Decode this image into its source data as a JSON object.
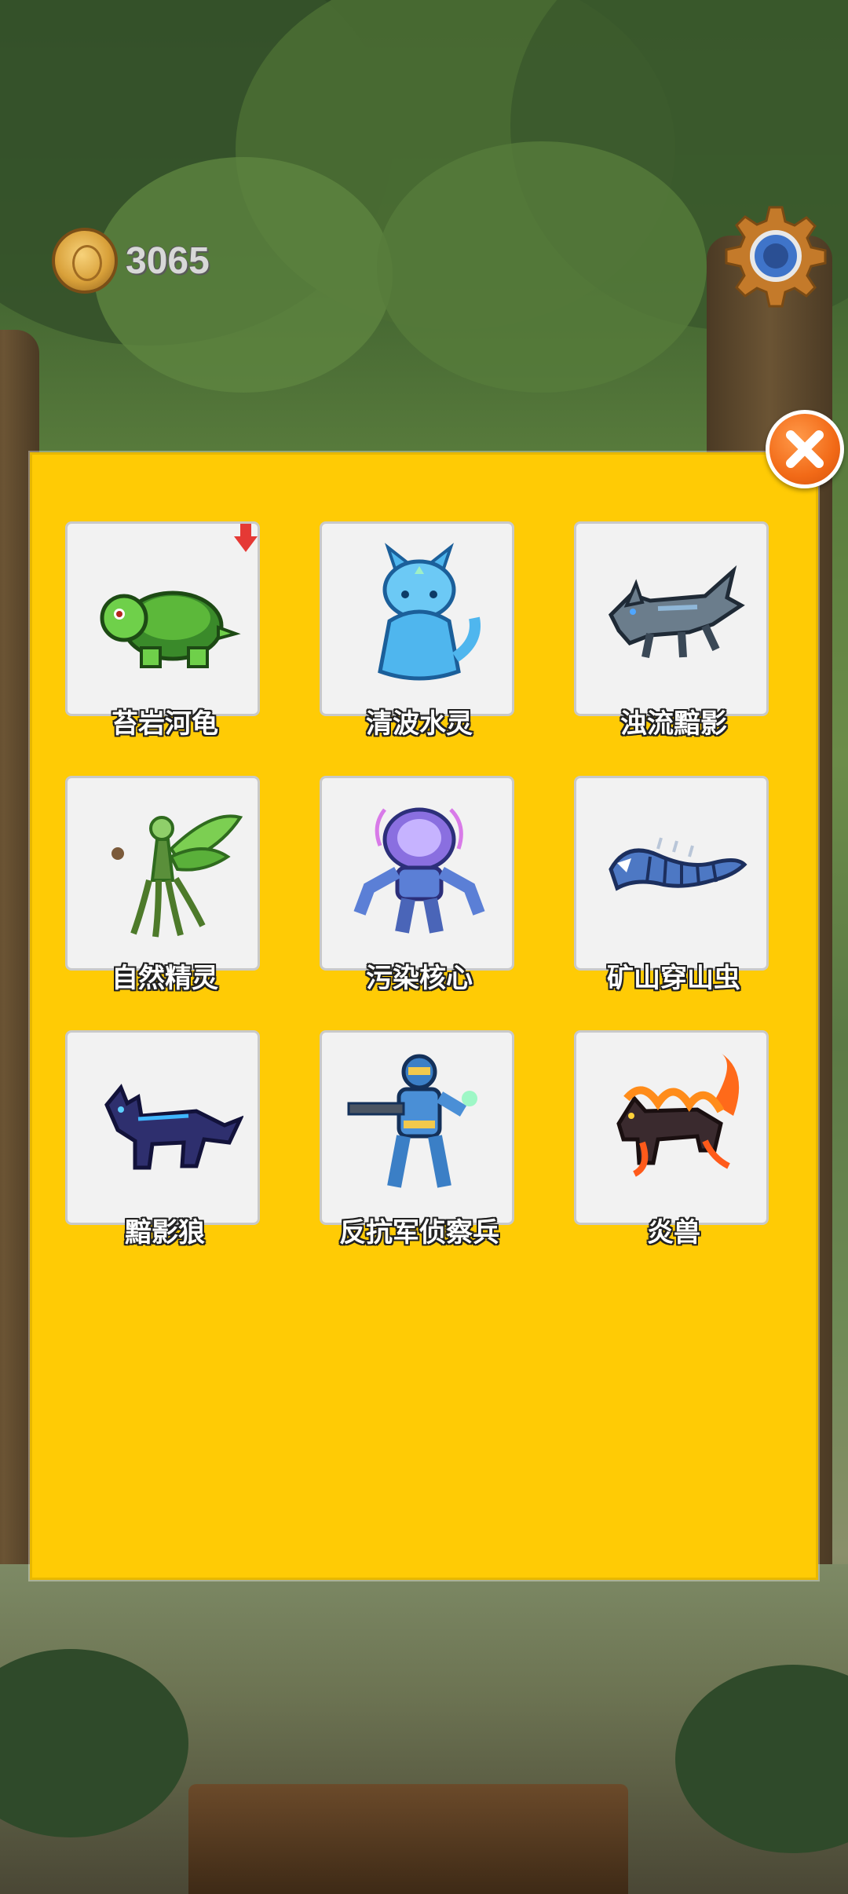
{
  "hud": {
    "coins": "3065",
    "coin_icon": "gold-coin-icon",
    "settings_icon": "gear-icon"
  },
  "collection": {
    "close_icon": "close-icon",
    "monsters": [
      {
        "name": "苔岩河龟",
        "icon": "green-turtle-icon",
        "has_new_badge": true
      },
      {
        "name": "清波水灵",
        "icon": "water-spirit-icon",
        "has_new_badge": false
      },
      {
        "name": "浊流黯影",
        "icon": "shadow-wolf-icon",
        "has_new_badge": false
      },
      {
        "name": "自然精灵",
        "icon": "nature-fairy-icon",
        "has_new_badge": false
      },
      {
        "name": "污染核心",
        "icon": "crystal-robot-icon",
        "has_new_badge": false
      },
      {
        "name": "矿山穿山虫",
        "icon": "mine-worm-icon",
        "has_new_badge": false
      },
      {
        "name": "黯影狼",
        "icon": "dark-wolf-icon",
        "has_new_badge": false
      },
      {
        "name": "反抗军侦察兵",
        "icon": "rebel-scout-icon",
        "has_new_badge": false
      },
      {
        "name": "炎兽",
        "icon": "fire-beast-icon",
        "has_new_badge": false
      }
    ]
  },
  "colors": {
    "panel": "#ffcb05",
    "card": "#f2f2f2",
    "close": "#f26a17"
  }
}
